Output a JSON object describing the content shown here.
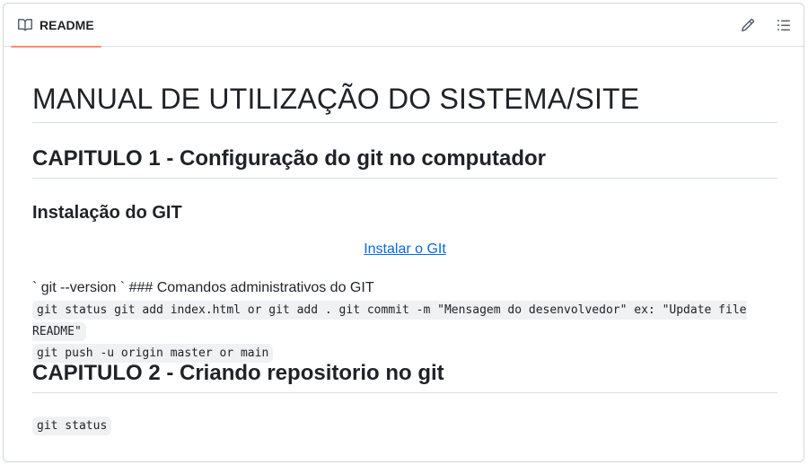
{
  "header": {
    "tab_label": "README",
    "icons": {
      "tab": "book-icon",
      "edit": "pencil-icon",
      "outline": "list-icon"
    }
  },
  "readme": {
    "title": "MANUAL DE UTILIZAÇÃO DO SISTEMA/SITE",
    "chapter1": "CAPITULO 1 - Configuração do git no computador",
    "section_install": "Instalação do GIT",
    "install_link": "Instalar o GIt",
    "paragraph": "` git --version ` ### Comandos administrativos do GIT",
    "code_line1": "git status git add index.html or git add . git commit -m \"Mensagem do desenvolvedor\" ex: \"Update file README\"",
    "code_line2": "git push -u origin master or main",
    "chapter2": "CAPITULO 2 - Criando repositorio no git",
    "code_status": "git status"
  },
  "colors": {
    "accent_underline": "#fd8c73",
    "link": "#0969da",
    "border": "#d0d7de"
  }
}
